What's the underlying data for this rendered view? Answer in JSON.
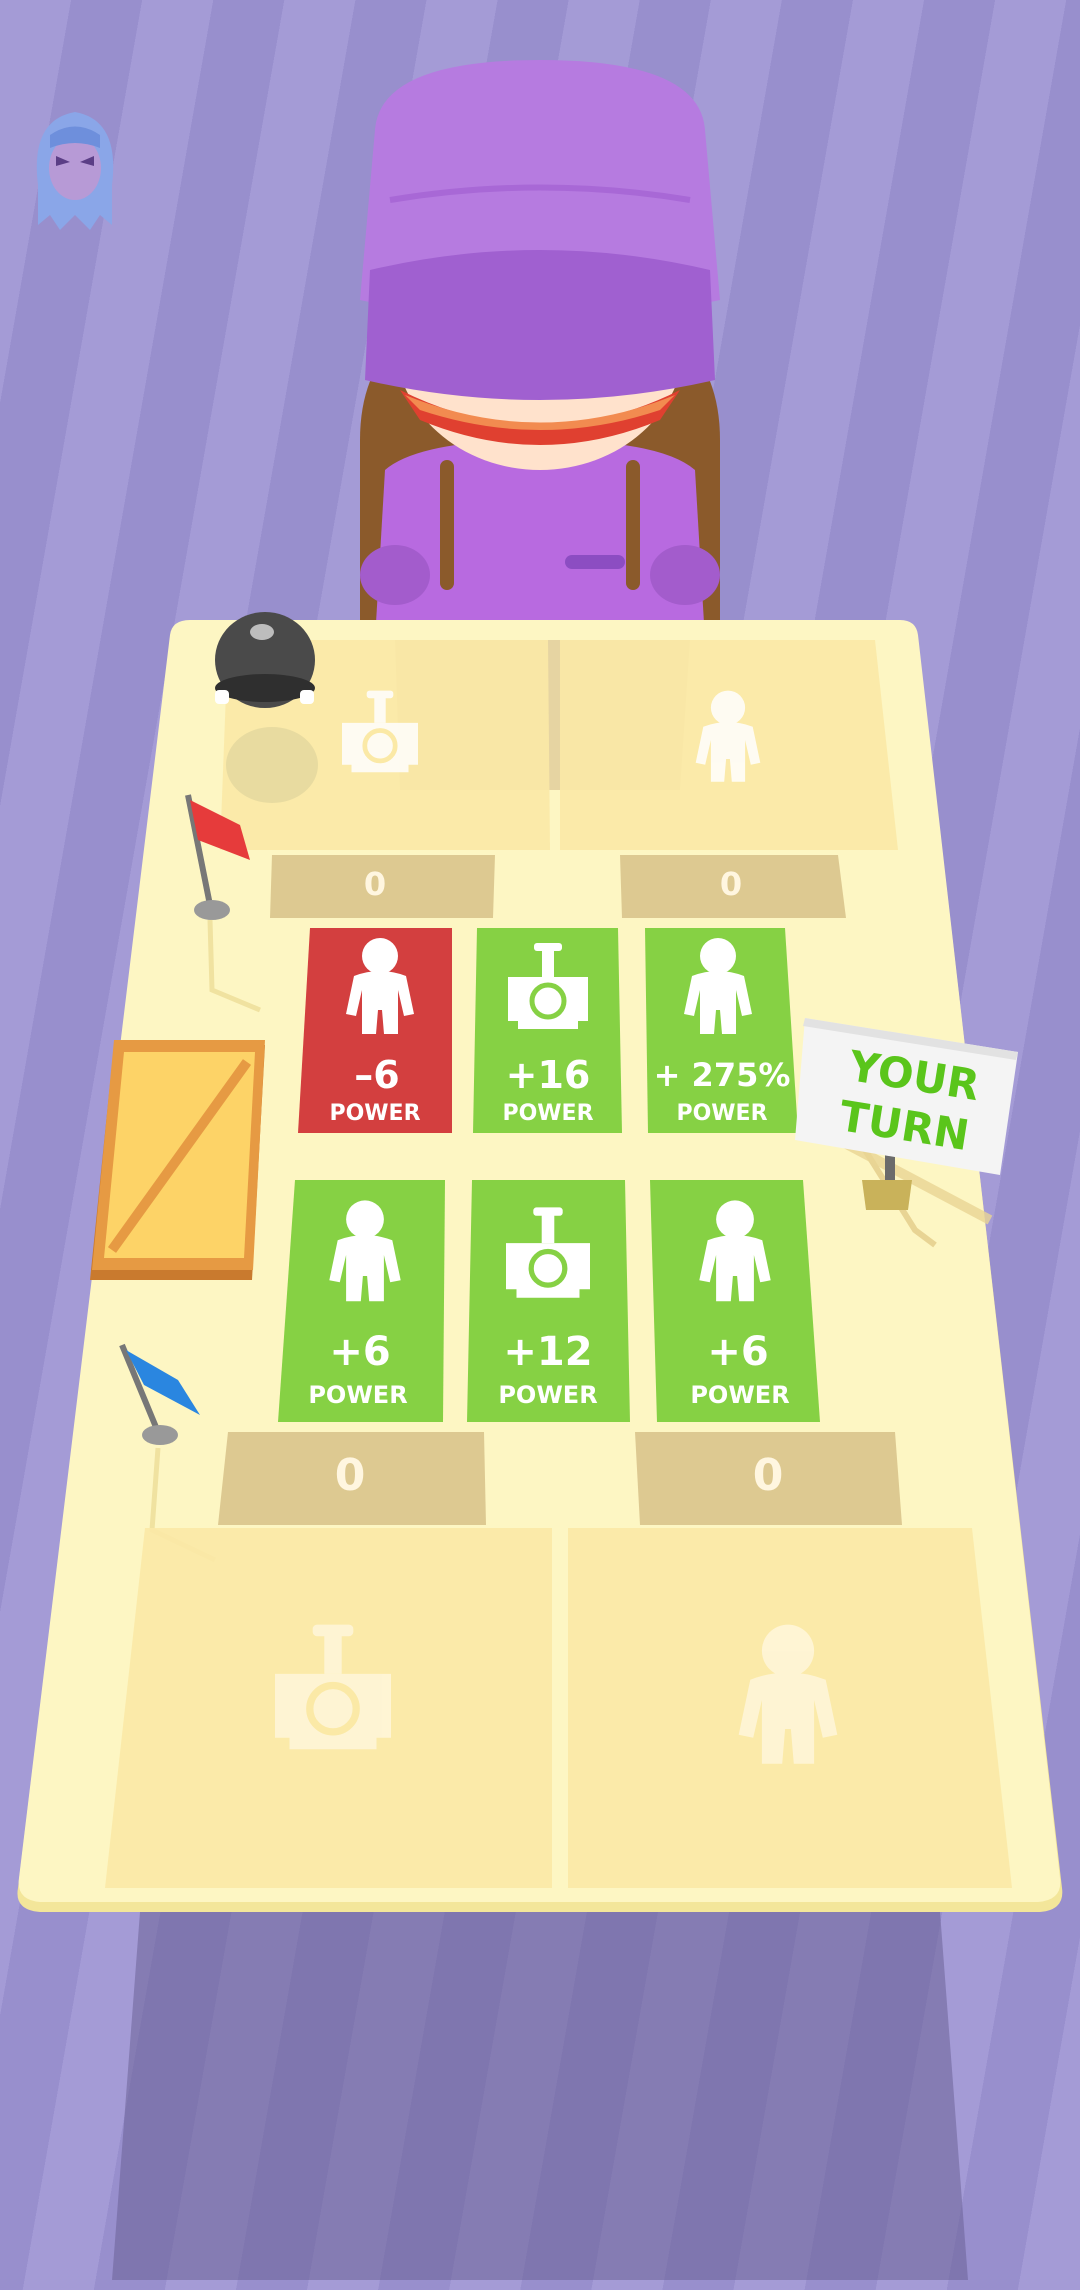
{
  "opponent": {
    "avatar_icon": "masked-face-icon"
  },
  "scores": {
    "opponent_left": "0",
    "opponent_right": "0",
    "player_left": "0",
    "player_right": "0"
  },
  "opponent_slots": [
    {
      "unit": "tank-icon"
    },
    {
      "unit": "soldier-icon"
    }
  ],
  "player_slots": [
    {
      "unit": "tank-icon"
    },
    {
      "unit": "soldier-icon"
    }
  ],
  "cards_row1": [
    {
      "value": "–6",
      "label": "POWER",
      "unit": "soldier-icon",
      "color": "#d33f3f"
    },
    {
      "value": "+16",
      "label": "POWER",
      "unit": "tank-icon",
      "color": "#86d144"
    },
    {
      "value": "+ 275%",
      "label": "POWER",
      "unit": "soldier-icon",
      "color": "#86d144"
    }
  ],
  "cards_row2": [
    {
      "value": "+6",
      "label": "POWER",
      "unit": "soldier-icon",
      "color": "#86d144"
    },
    {
      "value": "+12",
      "label": "POWER",
      "unit": "tank-icon",
      "color": "#86d144"
    },
    {
      "value": "+6",
      "label": "POWER",
      "unit": "soldier-icon",
      "color": "#86d144"
    }
  ],
  "sign": {
    "line1": "YOUR",
    "line2": "TURN"
  },
  "colors": {
    "table": "#fdf6c3",
    "slot": "#fbe9a6",
    "score_box": "#d9c48c",
    "card_red": "#d33f3f",
    "card_green": "#86d144",
    "sign_text": "#5ac51b"
  }
}
